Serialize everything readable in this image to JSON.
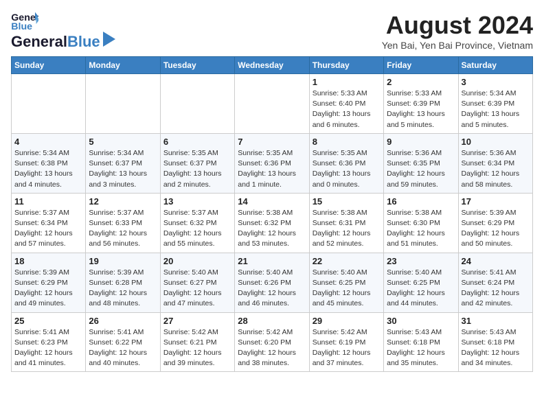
{
  "header": {
    "logo_general": "General",
    "logo_blue": "Blue",
    "month_title": "August 2024",
    "location": "Yen Bai, Yen Bai Province, Vietnam"
  },
  "days_of_week": [
    "Sunday",
    "Monday",
    "Tuesday",
    "Wednesday",
    "Thursday",
    "Friday",
    "Saturday"
  ],
  "weeks": [
    [
      {
        "num": "",
        "info": ""
      },
      {
        "num": "",
        "info": ""
      },
      {
        "num": "",
        "info": ""
      },
      {
        "num": "",
        "info": ""
      },
      {
        "num": "1",
        "info": "Sunrise: 5:33 AM\nSunset: 6:40 PM\nDaylight: 13 hours\nand 6 minutes."
      },
      {
        "num": "2",
        "info": "Sunrise: 5:33 AM\nSunset: 6:39 PM\nDaylight: 13 hours\nand 5 minutes."
      },
      {
        "num": "3",
        "info": "Sunrise: 5:34 AM\nSunset: 6:39 PM\nDaylight: 13 hours\nand 5 minutes."
      }
    ],
    [
      {
        "num": "4",
        "info": "Sunrise: 5:34 AM\nSunset: 6:38 PM\nDaylight: 13 hours\nand 4 minutes."
      },
      {
        "num": "5",
        "info": "Sunrise: 5:34 AM\nSunset: 6:37 PM\nDaylight: 13 hours\nand 3 minutes."
      },
      {
        "num": "6",
        "info": "Sunrise: 5:35 AM\nSunset: 6:37 PM\nDaylight: 13 hours\nand 2 minutes."
      },
      {
        "num": "7",
        "info": "Sunrise: 5:35 AM\nSunset: 6:36 PM\nDaylight: 13 hours\nand 1 minute."
      },
      {
        "num": "8",
        "info": "Sunrise: 5:35 AM\nSunset: 6:36 PM\nDaylight: 13 hours\nand 0 minutes."
      },
      {
        "num": "9",
        "info": "Sunrise: 5:36 AM\nSunset: 6:35 PM\nDaylight: 12 hours\nand 59 minutes."
      },
      {
        "num": "10",
        "info": "Sunrise: 5:36 AM\nSunset: 6:34 PM\nDaylight: 12 hours\nand 58 minutes."
      }
    ],
    [
      {
        "num": "11",
        "info": "Sunrise: 5:37 AM\nSunset: 6:34 PM\nDaylight: 12 hours\nand 57 minutes."
      },
      {
        "num": "12",
        "info": "Sunrise: 5:37 AM\nSunset: 6:33 PM\nDaylight: 12 hours\nand 56 minutes."
      },
      {
        "num": "13",
        "info": "Sunrise: 5:37 AM\nSunset: 6:32 PM\nDaylight: 12 hours\nand 55 minutes."
      },
      {
        "num": "14",
        "info": "Sunrise: 5:38 AM\nSunset: 6:32 PM\nDaylight: 12 hours\nand 53 minutes."
      },
      {
        "num": "15",
        "info": "Sunrise: 5:38 AM\nSunset: 6:31 PM\nDaylight: 12 hours\nand 52 minutes."
      },
      {
        "num": "16",
        "info": "Sunrise: 5:38 AM\nSunset: 6:30 PM\nDaylight: 12 hours\nand 51 minutes."
      },
      {
        "num": "17",
        "info": "Sunrise: 5:39 AM\nSunset: 6:29 PM\nDaylight: 12 hours\nand 50 minutes."
      }
    ],
    [
      {
        "num": "18",
        "info": "Sunrise: 5:39 AM\nSunset: 6:29 PM\nDaylight: 12 hours\nand 49 minutes."
      },
      {
        "num": "19",
        "info": "Sunrise: 5:39 AM\nSunset: 6:28 PM\nDaylight: 12 hours\nand 48 minutes."
      },
      {
        "num": "20",
        "info": "Sunrise: 5:40 AM\nSunset: 6:27 PM\nDaylight: 12 hours\nand 47 minutes."
      },
      {
        "num": "21",
        "info": "Sunrise: 5:40 AM\nSunset: 6:26 PM\nDaylight: 12 hours\nand 46 minutes."
      },
      {
        "num": "22",
        "info": "Sunrise: 5:40 AM\nSunset: 6:25 PM\nDaylight: 12 hours\nand 45 minutes."
      },
      {
        "num": "23",
        "info": "Sunrise: 5:40 AM\nSunset: 6:25 PM\nDaylight: 12 hours\nand 44 minutes."
      },
      {
        "num": "24",
        "info": "Sunrise: 5:41 AM\nSunset: 6:24 PM\nDaylight: 12 hours\nand 42 minutes."
      }
    ],
    [
      {
        "num": "25",
        "info": "Sunrise: 5:41 AM\nSunset: 6:23 PM\nDaylight: 12 hours\nand 41 minutes."
      },
      {
        "num": "26",
        "info": "Sunrise: 5:41 AM\nSunset: 6:22 PM\nDaylight: 12 hours\nand 40 minutes."
      },
      {
        "num": "27",
        "info": "Sunrise: 5:42 AM\nSunset: 6:21 PM\nDaylight: 12 hours\nand 39 minutes."
      },
      {
        "num": "28",
        "info": "Sunrise: 5:42 AM\nSunset: 6:20 PM\nDaylight: 12 hours\nand 38 minutes."
      },
      {
        "num": "29",
        "info": "Sunrise: 5:42 AM\nSunset: 6:19 PM\nDaylight: 12 hours\nand 37 minutes."
      },
      {
        "num": "30",
        "info": "Sunrise: 5:43 AM\nSunset: 6:18 PM\nDaylight: 12 hours\nand 35 minutes."
      },
      {
        "num": "31",
        "info": "Sunrise: 5:43 AM\nSunset: 6:18 PM\nDaylight: 12 hours\nand 34 minutes."
      }
    ]
  ]
}
